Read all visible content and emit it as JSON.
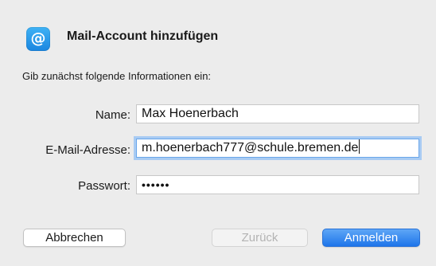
{
  "dialog": {
    "title": "Mail-Account hinzufügen",
    "app_icon_symbol": "@",
    "app_icon": "mail-at-icon",
    "intro": "Gib zunächst folgende Informationen ein:",
    "accent_color": "#1e75ea"
  },
  "form": {
    "name_label": "Name:",
    "name_value": "Max Hoenerbach",
    "email_label": "E-Mail-Adresse:",
    "email_value": "m.hoenerbach777@schule.bremen.de",
    "password_label": "Passwort:",
    "password_value": "••••••"
  },
  "buttons": {
    "cancel": "Abbrechen",
    "back": "Zurück",
    "login": "Anmelden"
  }
}
